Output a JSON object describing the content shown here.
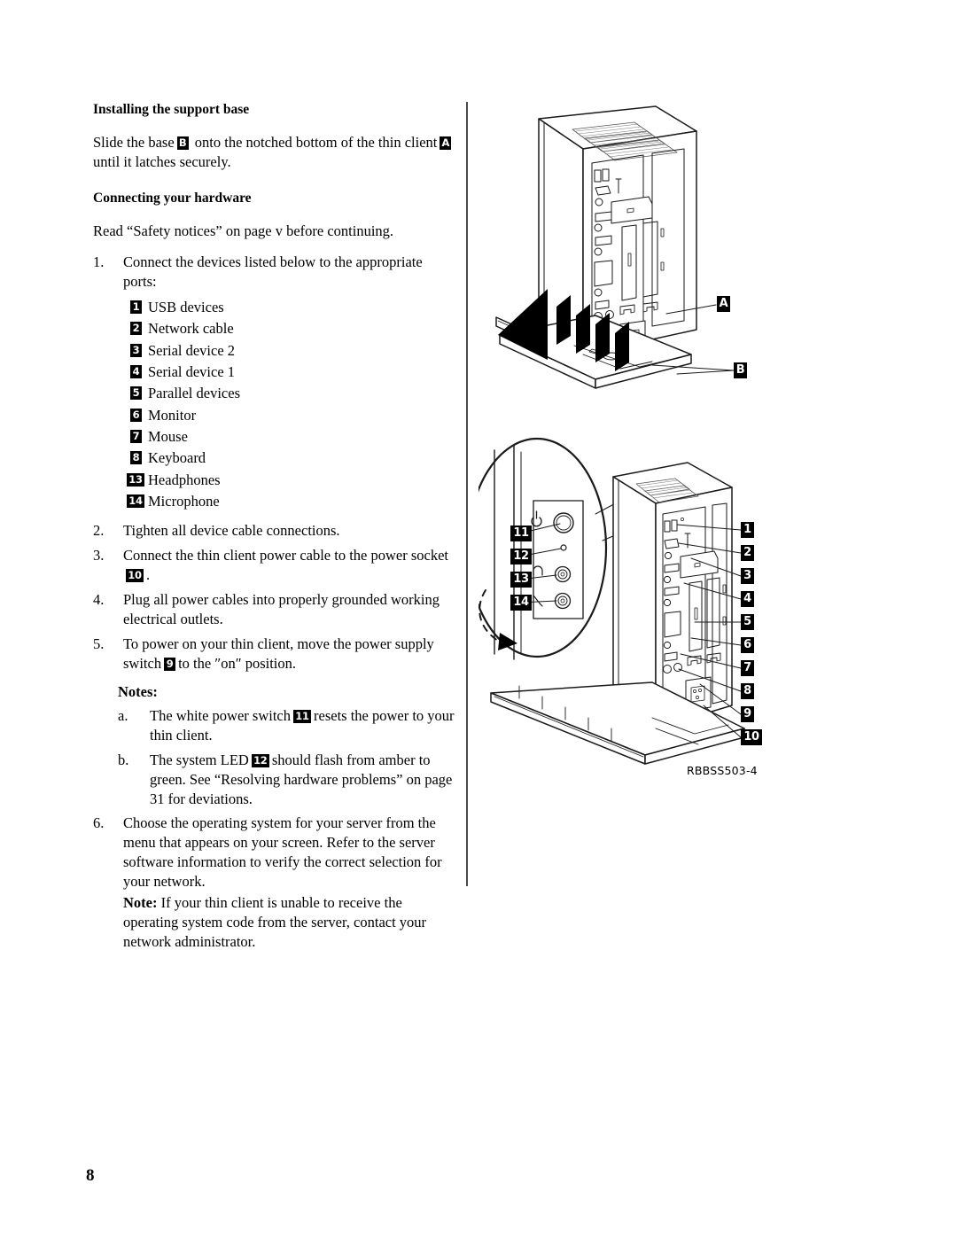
{
  "page": {
    "number": "8"
  },
  "sections": {
    "support_base": {
      "heading": "Installing the support base",
      "body_a": "Slide the base",
      "badge_b": "B",
      "body_b": "onto the notched bottom of the thin client",
      "badge_a": "A",
      "body_c": "until it latches securely."
    },
    "connecting": {
      "heading": "Connecting your hardware",
      "intro": "Read “Safety notices” on page v before continuing."
    }
  },
  "steps": [
    {
      "marker": "1.",
      "text": "Connect the devices listed below to the appropriate ports:"
    },
    {
      "marker": "2.",
      "text": "Tighten all device cable connections."
    },
    {
      "marker": "3.",
      "pre": "Connect the thin client power cable to the power socket",
      "badge": "10",
      "post": "."
    },
    {
      "marker": "4.",
      "text": "Plug all power cables into properly grounded working electrical outlets."
    },
    {
      "marker": "5.",
      "pre": "To power on your thin client, move the power supply switch",
      "badge": "9",
      "post": "to the ″on″ position."
    },
    {
      "marker": "6.",
      "text": "Choose the operating system for your server from the menu that appears on your screen. Refer to the server software information to verify the correct selection for your network."
    }
  ],
  "device_list": {
    "items": [
      {
        "badge": "1",
        "label": "USB devices"
      },
      {
        "badge": "2",
        "label": "Network cable"
      },
      {
        "badge": "3",
        "label": "Serial device 2"
      },
      {
        "badge": "4",
        "label": "Serial device 1"
      },
      {
        "badge": "5",
        "label": "Parallel devices"
      },
      {
        "badge": "6",
        "label": "Monitor"
      },
      {
        "badge": "7",
        "label": "Mouse"
      },
      {
        "badge": "8",
        "label": "Keyboard"
      },
      {
        "badge": "13",
        "label": "Headphones"
      },
      {
        "badge": "14",
        "label": "Microphone"
      }
    ]
  },
  "notes": {
    "title": "Notes:",
    "items": [
      {
        "marker": "a.",
        "pre": "The white power switch",
        "badge": "11",
        "post": "resets the power to your thin client."
      },
      {
        "marker": "b.",
        "pre": "The system LED",
        "badge": "12",
        "post": "should flash from amber to green. See “Resolving hardware problems” on page 31 for deviations."
      }
    ]
  },
  "step6_note": {
    "label": "Note:",
    "text": "If your thin client is unable to receive the operating system code from the server, contact your network administrator."
  },
  "figure": {
    "caption": "RBBSS503-4",
    "callouts": {
      "a": "A",
      "b": "B",
      "rear": [
        "1",
        "2",
        "3",
        "4",
        "5",
        "6",
        "7",
        "8",
        "9",
        "10"
      ],
      "front": [
        "11",
        "12",
        "13",
        "14"
      ]
    }
  }
}
